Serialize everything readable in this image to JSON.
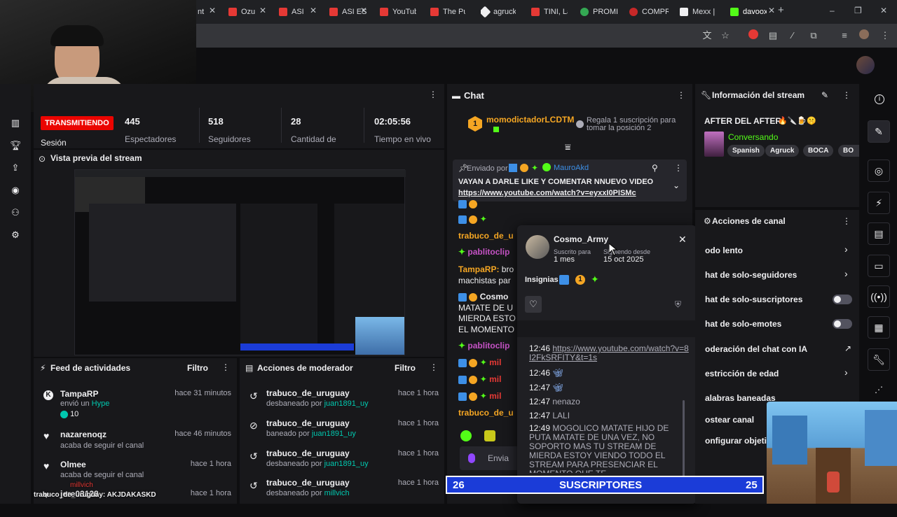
{
  "browser": {
    "tabs": [
      "nt",
      "Ozu",
      "ASI",
      "ASI ES E",
      "YouTub",
      "The Pu",
      "agruck",
      "TINI, La",
      "PROMI",
      "COMPR",
      "Mexx |",
      "davoox"
    ],
    "new_tab": "+",
    "window_controls": [
      "–",
      "❐",
      "✕"
    ]
  },
  "stats": {
    "live_badge": "TRANSMITIENDO",
    "session_label": "Sesión",
    "items": [
      {
        "value": "445",
        "label": "Espectadores"
      },
      {
        "value": "518",
        "label": "Seguidores"
      },
      {
        "value": "28",
        "label": "Cantidad de"
      },
      {
        "value": "02:05:56",
        "label": "Tiempo en vivo"
      }
    ]
  },
  "preview": {
    "title": "Vista previa del stream"
  },
  "activity": {
    "title": "Feed de actividades",
    "filter": "Filtro",
    "items": [
      {
        "name": "TampaRP",
        "sub_prefix": "envió un",
        "sub_highlight": "Hype",
        "extra": "10",
        "time": "hace 31 minutos"
      },
      {
        "name": "nazarenoqz",
        "sub_prefix": "acaba de seguir el canal",
        "sub_highlight": "",
        "extra": "",
        "time": "hace 46 minutos"
      },
      {
        "name": "Olmee",
        "sub_prefix": "acaba de seguir el canal",
        "sub_highlight": "",
        "extra": "",
        "time": "hace 1 hora"
      },
      {
        "name": "jere03128",
        "sub_prefix": "",
        "sub_highlight": "",
        "extra": "",
        "time": "hace 1 hora"
      }
    ]
  },
  "overlay_text": {
    "line1": "millvich",
    "line2": "trabuco_de_uruguay: AKJDAKASKD"
  },
  "moderator": {
    "title": "Acciones de moderador",
    "filter": "Filtro",
    "items": [
      {
        "user": "trabuco_de_uruguay",
        "action": "desbaneado por",
        "by": "juan1891_uy",
        "time": "hace 1 hora"
      },
      {
        "user": "trabuco_de_uruguay",
        "action": "baneado por",
        "by": "juan1891_uy",
        "time": "hace 1 hora"
      },
      {
        "user": "trabuco_de_uruguay",
        "action": "desbaneado por",
        "by": "juan1891_uy",
        "time": "hace 1 hora"
      },
      {
        "user": "trabuco_de_uruguay",
        "action": "desbaneado por",
        "by": "millvich",
        "time": "hace 1 hora"
      }
    ]
  },
  "chat": {
    "title": "Chat",
    "top_gifter": "momodictadorLCDTM",
    "top_gifter_badge": "1",
    "gift_prompt": "Regala 1 suscripción para tomar la posición 2",
    "pinned_by_label": "Enviado por",
    "pinned_by_user": "MauroAkd",
    "pinned_text": "VAYAN A DARLE LIKE Y COMENTAR NNUEVO VIDEO",
    "pinned_link": "https://www.youtube.com/watch?v=eyxxI0PISMc",
    "lines": [
      {
        "user": "trabuco_de_u",
        "text": ""
      },
      {
        "user": "pablitoclip",
        "text": ""
      },
      {
        "user": "TampaRP:",
        "text": "bro"
      },
      {
        "user": "",
        "text": "machistas par"
      },
      {
        "user": "Cosmo",
        "text": ""
      },
      {
        "user": "",
        "text": "MATATE DE U"
      },
      {
        "user": "",
        "text": "MIERDA ESTO"
      },
      {
        "user": "",
        "text": "EL MOMENTO"
      },
      {
        "user": "pablitoclip",
        "text": ""
      },
      {
        "user": "mil",
        "text": ""
      },
      {
        "user": "mil",
        "text": ""
      },
      {
        "user": "mil",
        "text": ""
      },
      {
        "user": "trabuco_de_u",
        "text": ""
      }
    ],
    "input_placeholder": "Envia"
  },
  "usercard": {
    "username": "Cosmo_Army",
    "sub_label": "Suscrito para",
    "sub_value": "1 mes",
    "follow_label": "Siguiendo desde",
    "follow_value": "15 oct 2025",
    "badges_label": "Insignias",
    "badge_number": "1",
    "messages": [
      {
        "time": "12:46",
        "text": "https://www.youtube.com/watch?v=8I2FkSRFITY&t=1s",
        "link": true
      },
      {
        "time": "12:46",
        "text": "",
        "link": false
      },
      {
        "time": "12:47",
        "text": "",
        "link": false
      },
      {
        "time": "12:47",
        "text": "nenazo",
        "link": false
      },
      {
        "time": "12:47",
        "text": "LALI",
        "link": false
      },
      {
        "time": "12:49",
        "text": "MOGOLICO MATATE HIJO DE PUTA MATATE DE UNA VEZ, NO SOPORTO MAS TU STREAM DE MIERDA ESTOY VIENDO TODO EL STREAM PARA PRESENCIAR EL MOMENTO QUE TE",
        "link": false
      }
    ]
  },
  "stream_info": {
    "title": "Información del stream",
    "stream_title": "AFTER DEL AFTER",
    "category": "Conversando",
    "tags": [
      "Spanish",
      "Agruck",
      "BOCA",
      "BO"
    ]
  },
  "channel_actions": {
    "title": "Acciones de canal",
    "rows": [
      {
        "label": "odo lento",
        "control": "chevron"
      },
      {
        "label": "hat de solo-seguidores",
        "control": "chevron"
      },
      {
        "label": "hat de solo-suscriptores",
        "control": "toggle"
      },
      {
        "label": "hat de solo-emotes",
        "control": "toggle"
      },
      {
        "label": "oderación del chat con IA",
        "control": "external"
      },
      {
        "label": "estricción de edad",
        "control": "chevron"
      },
      {
        "label": "alabras baneadas",
        "control": "chevron"
      },
      {
        "label": "ostear canal",
        "control": "none"
      },
      {
        "label": "onfigurar objetiv",
        "control": "none"
      }
    ]
  },
  "sub_goal": {
    "left": "26",
    "label": "SUSCRIPTORES",
    "right": "25"
  },
  "colors": {
    "live": "#eb0400",
    "accent": "#bf94ff",
    "green": "#00c8af",
    "goal_bg": "#1b3cd8"
  }
}
